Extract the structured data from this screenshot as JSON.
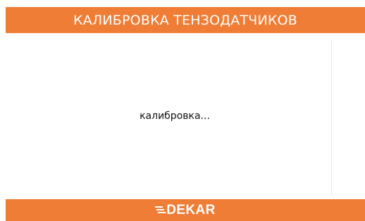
{
  "header": {
    "title": "КАЛИБРОВКА ТЕНЗОДАТЧИКОВ"
  },
  "main": {
    "status_text": "калибровка..."
  },
  "footer": {
    "logo_text": "DEKAR",
    "logo_icon": "stripes-icon"
  },
  "colors": {
    "accent": "#ef7d35",
    "background": "#ffffff",
    "text": "#111111"
  }
}
